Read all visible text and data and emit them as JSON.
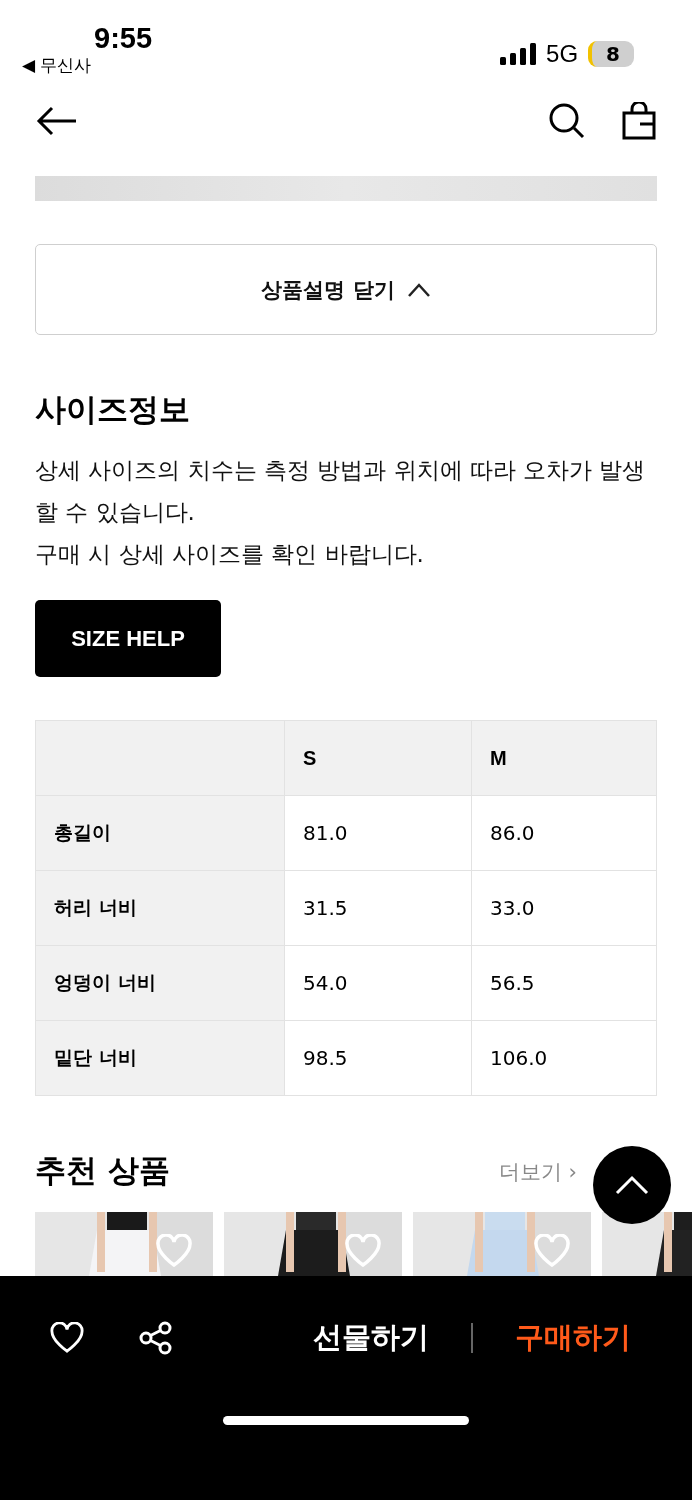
{
  "status_bar": {
    "time": "9:55",
    "back_app": "◀ 무신사",
    "network": "5G",
    "battery": "8"
  },
  "description_toggle": {
    "label": "상품설명 닫기",
    "expanded": true
  },
  "size_info": {
    "title": "사이즈정보",
    "notice": "상세 사이즈의 치수는 측정 방법과 위치에 따라 오차가 발생할 수 있습니다.\n구매 시 상세 사이즈를 확인 바랍니다.",
    "help_button": "SIZE HELP",
    "table": {
      "columns": [
        "S",
        "M"
      ],
      "rows": [
        {
          "label": "총길이",
          "values": [
            "81.0",
            "86.0"
          ]
        },
        {
          "label": "허리 너비",
          "values": [
            "31.5",
            "33.0"
          ]
        },
        {
          "label": "엉덩이 너비",
          "values": [
            "54.0",
            "56.5"
          ]
        },
        {
          "label": "밑단 너비",
          "values": [
            "98.5",
            "106.0"
          ]
        }
      ]
    }
  },
  "recommended": {
    "title": "추천 상품",
    "more": "더보기 ›"
  },
  "bottom_bar": {
    "gift": "선물하기",
    "buy": "구매하기"
  }
}
